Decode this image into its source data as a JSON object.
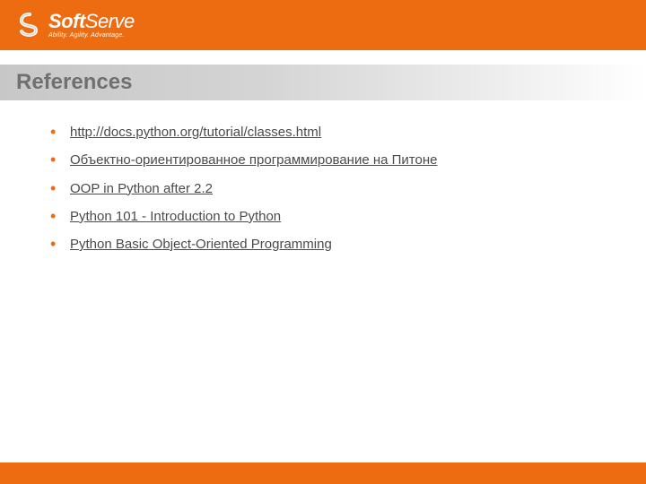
{
  "logo": {
    "brand_bold": "Soft",
    "brand_light": "Serve",
    "tagline": "Ability. Agility. Advantage."
  },
  "title": "References",
  "references": [
    "http://docs.python.org/tutorial/classes.html",
    "Объектно-ориентированное программирование на Питоне",
    "OOP in Python after 2.2",
    "Python 101 - Introduction to Python",
    "Python Basic Object-Oriented Programming"
  ]
}
